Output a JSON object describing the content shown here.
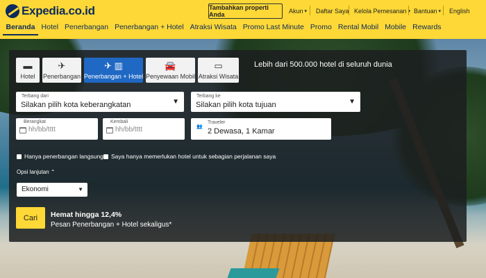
{
  "header": {
    "logo_text": "Expedia.co.id",
    "list_property_label": "Tambahkan properti Anda",
    "utility": [
      {
        "label": "Akun",
        "caret": "▾"
      },
      {
        "label": "Daftar Saya",
        "caret": ""
      },
      {
        "label": "Kelola Pemesanan",
        "caret": "▾"
      },
      {
        "label": "Bantuan",
        "caret": "▾"
      },
      {
        "label": "English",
        "caret": ""
      }
    ],
    "nav": [
      "Beranda",
      "Hotel",
      "Penerbangan",
      "Penerbangan + Hotel",
      "Atraksi Wisata",
      "Promo Last Minute",
      "Promo",
      "Rental Mobil",
      "Mobile",
      "Rewards"
    ]
  },
  "search": {
    "tabs": [
      {
        "label": "Hotel",
        "icon": "bed-icon",
        "glyph": "▬"
      },
      {
        "label": "Penerbangan",
        "icon": "plane-icon",
        "glyph": "✈"
      },
      {
        "label": "Penerbangan + Hotel",
        "icon": "plane-hotel-icon",
        "glyph": "✈ ▥"
      },
      {
        "label": "Penyewaan Mobil",
        "icon": "car-icon",
        "glyph": "🚘"
      },
      {
        "label": "Atraksi Wisata",
        "icon": "ticket-icon",
        "glyph": "▭"
      }
    ],
    "active_tab": "Penerbangan + Hotel",
    "tagline": "Lebih dari 500.000 hotel di seluruh dunia",
    "from": {
      "label": "Terbang dari",
      "value": "Silakan pilih kota keberangkatan"
    },
    "to": {
      "label": "Terbang ke",
      "value": "Silakan pilih kota tujuan"
    },
    "depart": {
      "label": "Berangkat",
      "placeholder": "hh/bb/tttt"
    },
    "return": {
      "label": "Kembali",
      "placeholder": "hh/bb/tttt"
    },
    "traveler": {
      "label": "Traveler",
      "value": "2 Dewasa, 1 Kamar"
    },
    "checkbox_direct": "Hanya penerbangan langsung",
    "checkbox_hotel_part": "Saya hanya memerlukan hotel untuk sebagian perjalanan saya",
    "advanced_label": "Opsi lanjutan ⌃",
    "cabin_class": "Ekonomi",
    "search_button": "Cari",
    "promo_title": "Hemat hingga 12,4%",
    "promo_subtitle": "Pesan Penerbangan + Hotel sekaligus*"
  },
  "colors": {
    "brand_yellow": "#fdd836",
    "brand_navy": "#0c2a5b",
    "active_tab": "#1f68c4"
  }
}
